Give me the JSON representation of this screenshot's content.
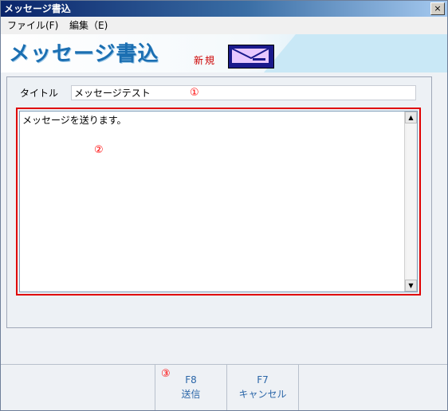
{
  "window": {
    "title": "メッセージ書込",
    "close_label": "×"
  },
  "menu": {
    "items": [
      {
        "label": "ファイル(F)"
      },
      {
        "label": "編集（E)"
      }
    ]
  },
  "banner": {
    "title": "メッセージ書込",
    "mode": "新規",
    "icon": "envelope-icon"
  },
  "form": {
    "title_label": "タイトル",
    "title_value": "メッセージテスト",
    "body_value": "メッセージを送ります。"
  },
  "callouts": {
    "c1": "①",
    "c2": "②",
    "c3": "③"
  },
  "footer": {
    "keys": [
      {
        "key": "F8",
        "label": "送信"
      },
      {
        "key": "F7",
        "label": "キャンセル"
      }
    ]
  },
  "colors": {
    "accent": "#1b6fb2",
    "highlight": "#e00000",
    "callout": "#ff0000",
    "key_text": "#2b66a8"
  }
}
